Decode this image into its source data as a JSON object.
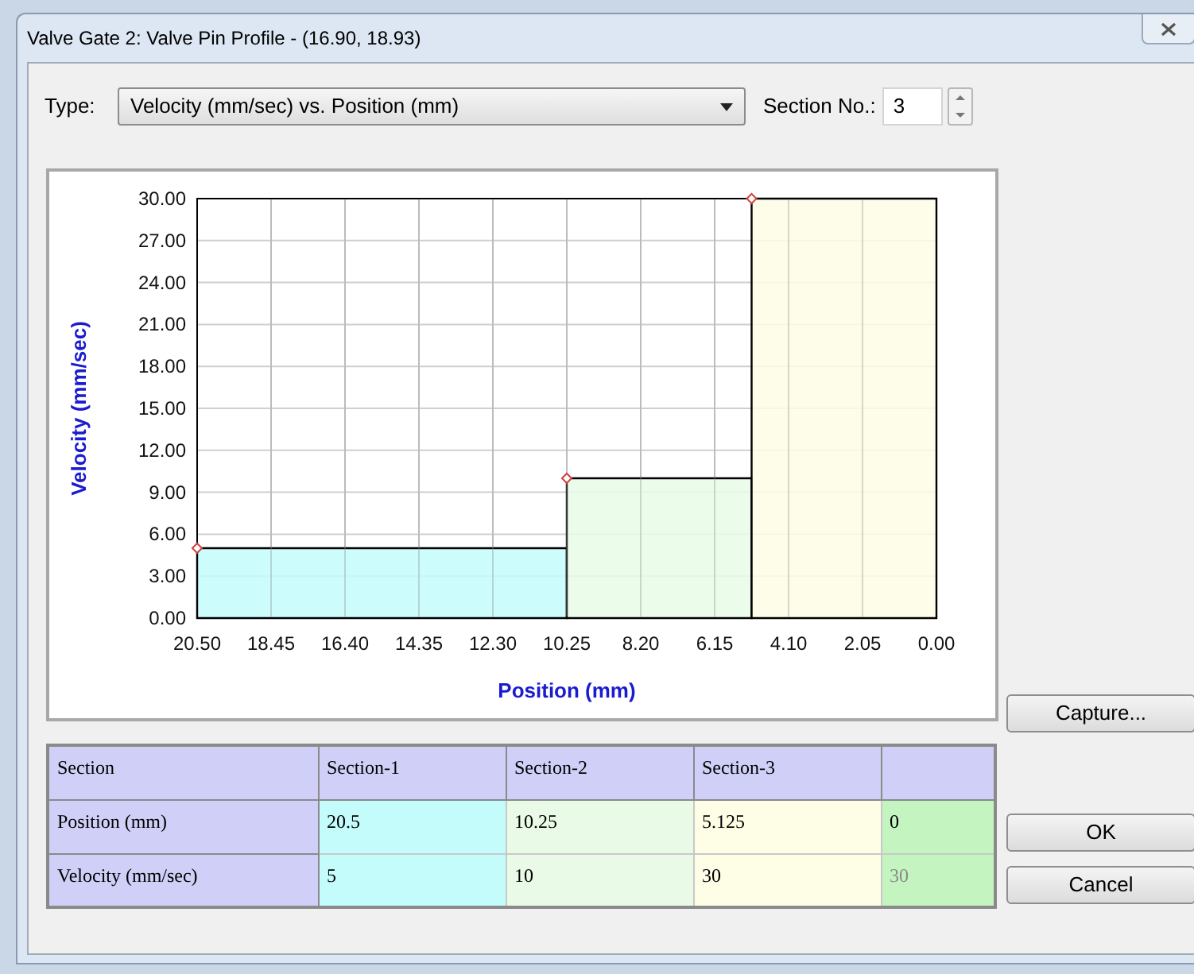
{
  "window": {
    "title": "Valve Gate 2: Valve Pin Profile - (16.90, 18.93)"
  },
  "type_field": {
    "label": "Type:",
    "value": "Velocity (mm/sec) vs. Position (mm)"
  },
  "section_no": {
    "label": "Section No.:",
    "value": "3"
  },
  "chart": {
    "chart_data": {
      "type": "area",
      "xlabel": "Position (mm)",
      "ylabel": "Velocity (mm/sec)",
      "x": [
        20.5,
        10.25,
        10.25,
        5.125,
        5.125,
        0
      ],
      "series": [
        {
          "color": "#c4fbfb",
          "values": [
            5,
            5,
            null,
            null,
            null,
            null
          ]
        },
        {
          "color": "#e9fbe7",
          "values": [
            null,
            null,
            10,
            10,
            null,
            null
          ]
        },
        {
          "color": "#fefde6",
          "values": [
            null,
            null,
            null,
            null,
            30,
            30
          ]
        }
      ],
      "xlim": [
        20.5,
        0
      ],
      "ylim": [
        0,
        30
      ],
      "grid": true,
      "xticks": [
        {
          "value": 20.5,
          "label": "20.50"
        },
        {
          "value": 18.45,
          "label": "18.45"
        },
        {
          "value": 16.4,
          "label": "16.40"
        },
        {
          "value": 14.35,
          "label": "14.35"
        },
        {
          "value": 12.3,
          "label": "12.30"
        },
        {
          "value": 10.25,
          "label": "10.25"
        },
        {
          "value": 8.2,
          "label": "8.20"
        },
        {
          "value": 6.15,
          "label": "6.15"
        },
        {
          "value": 4.1,
          "label": "4.10"
        },
        {
          "value": 2.05,
          "label": "2.05"
        },
        {
          "value": 0,
          "label": "0.00"
        }
      ],
      "yticks": [
        {
          "value": 0,
          "label": "0.00"
        },
        {
          "value": 3,
          "label": "3.00"
        },
        {
          "value": 6,
          "label": "6.00"
        },
        {
          "value": 9,
          "label": "9.00"
        },
        {
          "value": 12,
          "label": "12.00"
        },
        {
          "value": 15,
          "label": "15.00"
        },
        {
          "value": 18,
          "label": "18.00"
        },
        {
          "value": 21,
          "label": "21.00"
        },
        {
          "value": 24,
          "label": "24.00"
        },
        {
          "value": 27,
          "label": "27.00"
        },
        {
          "value": 30,
          "label": "30.00"
        }
      ]
    }
  },
  "table": {
    "columns": [
      {
        "label": "Section"
      },
      {
        "label": "Section-1",
        "color": "#c4fbfb"
      },
      {
        "label": "Section-2",
        "color": "#e9fbe7"
      },
      {
        "label": "Section-3",
        "color": "#fefde6"
      },
      {
        "color": "#c4f5c0"
      }
    ],
    "rows": [
      {
        "cells": [
          {
            "text": "Position (mm)",
            "disabled": false
          },
          {
            "text": "20.5",
            "disabled": false
          },
          {
            "text": "10.25",
            "disabled": false
          },
          {
            "text": "5.125",
            "disabled": false
          },
          {
            "text": "0",
            "disabled": false
          }
        ]
      },
      {
        "cells": [
          {
            "text": "Velocity (mm/sec)",
            "disabled": false
          },
          {
            "text": "5",
            "disabled": false
          },
          {
            "text": "10",
            "disabled": false
          },
          {
            "text": "30",
            "disabled": false
          },
          {
            "text": "30",
            "disabled": true
          }
        ]
      }
    ]
  },
  "buttons": [
    {
      "kind": "capture",
      "label": "Capture..."
    },
    {
      "kind": "ok",
      "label": "OK"
    },
    {
      "kind": "cancel",
      "label": "Cancel"
    }
  ]
}
